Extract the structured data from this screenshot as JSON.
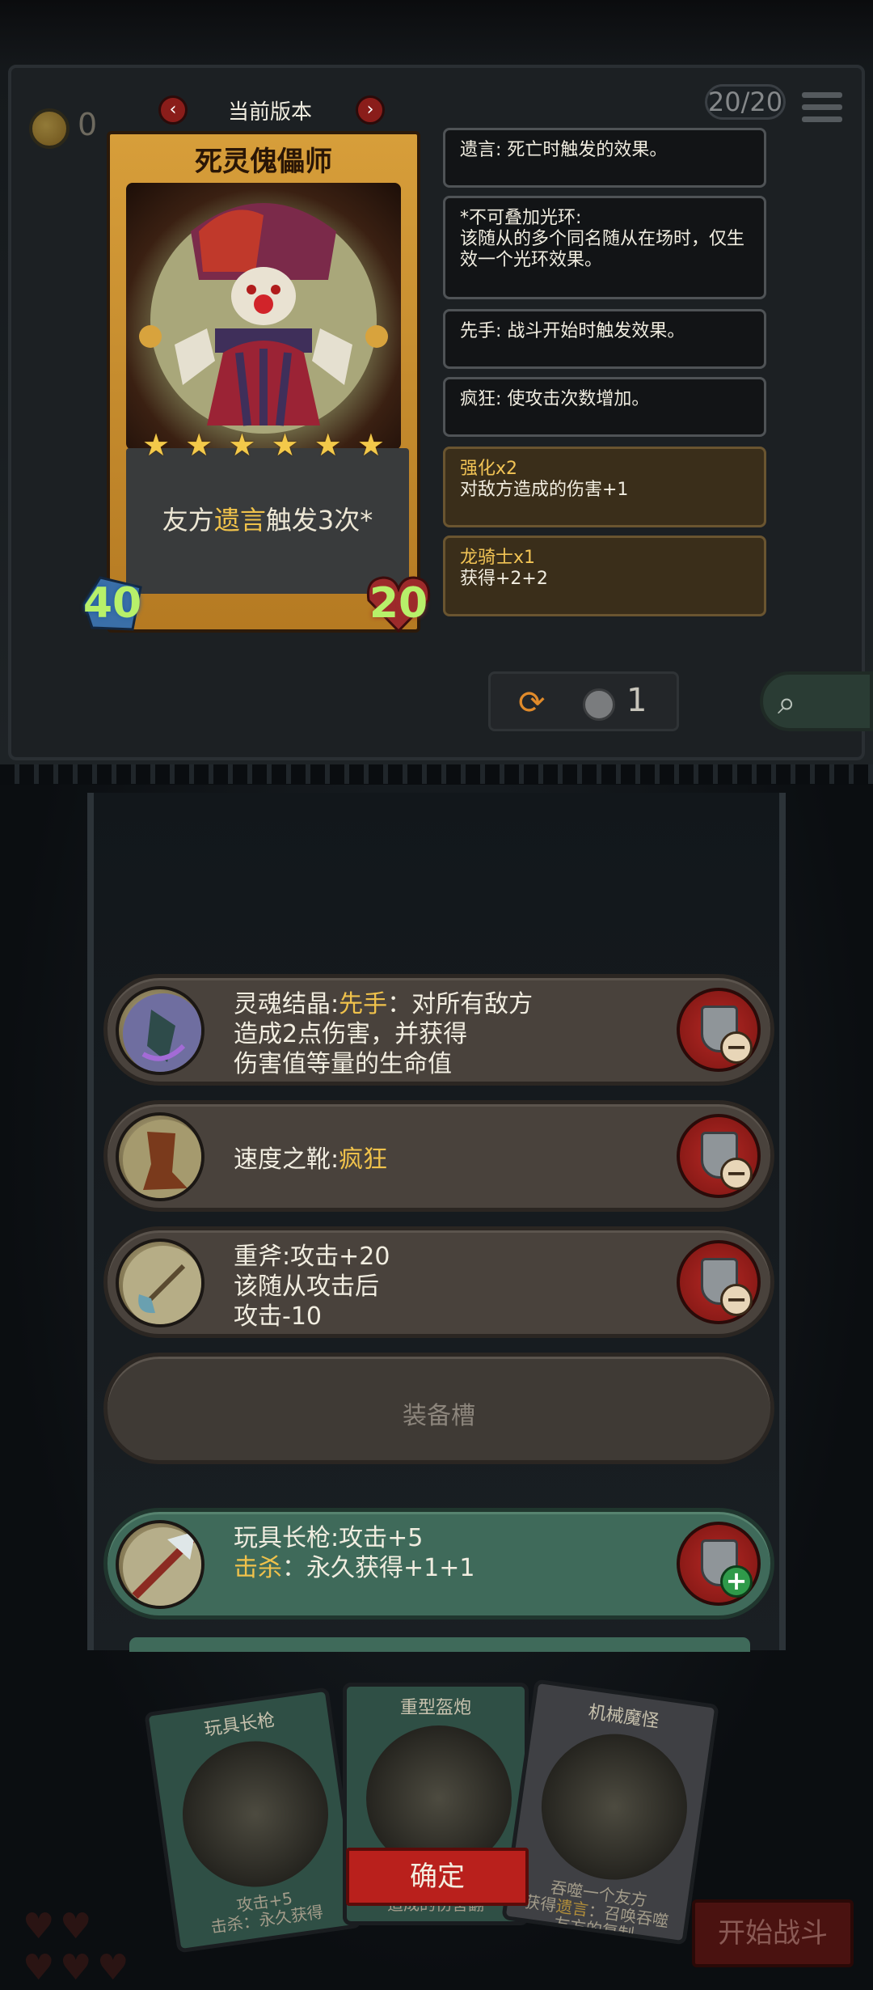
{
  "header": {
    "coins": "0",
    "version_label": "当前版本",
    "counter": "20/20",
    "prev_icon": "chevron-left-icon",
    "next_icon": "chevron-right-icon"
  },
  "card": {
    "name": "死灵傀儡师",
    "stars": 6,
    "text_before": "友方",
    "text_highlight": "遗言",
    "text_after": "触发3次*",
    "attack": "40",
    "health": "20"
  },
  "tooltips": [
    {
      "text": "遗言: 死亡时触发的效果。"
    },
    {
      "text": "*不可叠加光环:\n该随从的多个同名随从在场时，仅生效一个光环效果。"
    },
    {
      "text": "先手: 战斗开始时触发效果。"
    },
    {
      "text": "疯狂: 使攻击次数增加。"
    }
  ],
  "buffs": [
    {
      "title": "强化x2",
      "desc": "对敌方造成的伤害+1"
    },
    {
      "title": "龙骑士x1",
      "desc": "获得+2+2"
    }
  ],
  "actions": {
    "token_count": "1"
  },
  "equipment": [
    {
      "name": "灵魂结晶:",
      "hl": "先手",
      "rest": "：对所有敌方",
      "line2": "造成2点伤害，并获得",
      "line3": "伤害值等量的生命值"
    },
    {
      "name": "速度之靴:",
      "hl": "疯狂"
    },
    {
      "name": "重斧:攻击+20",
      "line2": "该随从攻击后",
      "line3": "攻击-10"
    }
  ],
  "empty_slot_label": "装备槽",
  "offer": {
    "line1": "玩具长枪:攻击+5",
    "hl": "击杀",
    "line2_rest": "：永久获得+1+1"
  },
  "hand_cards": [
    {
      "title": "玩具长枪",
      "line1": "攻击+5",
      "line2": "击杀：永久获得"
    },
    {
      "title": "重型盔炮",
      "line1": "",
      "line2": "造成的伤害翻"
    },
    {
      "title": "机械魔怪",
      "line1": "吞噬一个友方",
      "line2_pre": "获得",
      "line2_hl": "遗言",
      "line2_post": "：召唤吞噬",
      "line3": "友方的复制"
    }
  ],
  "buttons": {
    "confirm": "确定",
    "start_battle": "开始战斗"
  },
  "colors": {
    "gold": "#f0c24b",
    "red_button": "#b9201c",
    "green_slot": "#3f6a5a"
  }
}
